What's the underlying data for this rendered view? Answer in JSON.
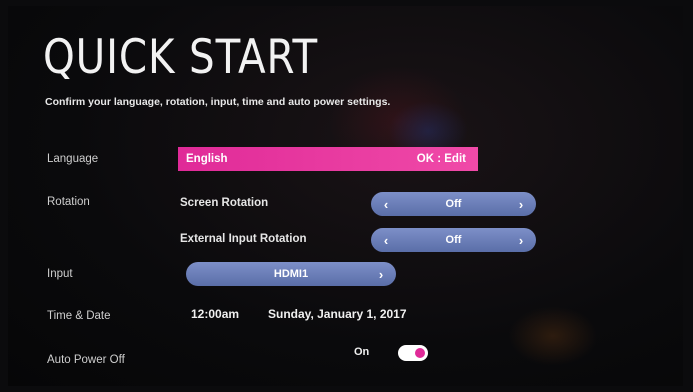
{
  "header": {
    "title": "QUICK START",
    "subtitle": "Confirm your language, rotation, input, time and auto power settings."
  },
  "language": {
    "label": "Language",
    "value": "English",
    "hint": "OK : Edit"
  },
  "rotation": {
    "label": "Rotation",
    "screen_rotation": {
      "label": "Screen Rotation",
      "value": "Off"
    },
    "external_input_rotation": {
      "label": "External Input Rotation",
      "value": "Off"
    }
  },
  "input": {
    "label": "Input",
    "value": "HDMI1"
  },
  "time_date": {
    "label": "Time & Date",
    "time": "12:00am",
    "date": "Sunday, January 1, 2017"
  },
  "auto_power_off": {
    "label": "Auto Power Off",
    "state": "On"
  },
  "icons": {
    "left": "‹",
    "right": "›"
  },
  "colors": {
    "accent": "#e02a98",
    "pill": "#6a7fbb"
  }
}
